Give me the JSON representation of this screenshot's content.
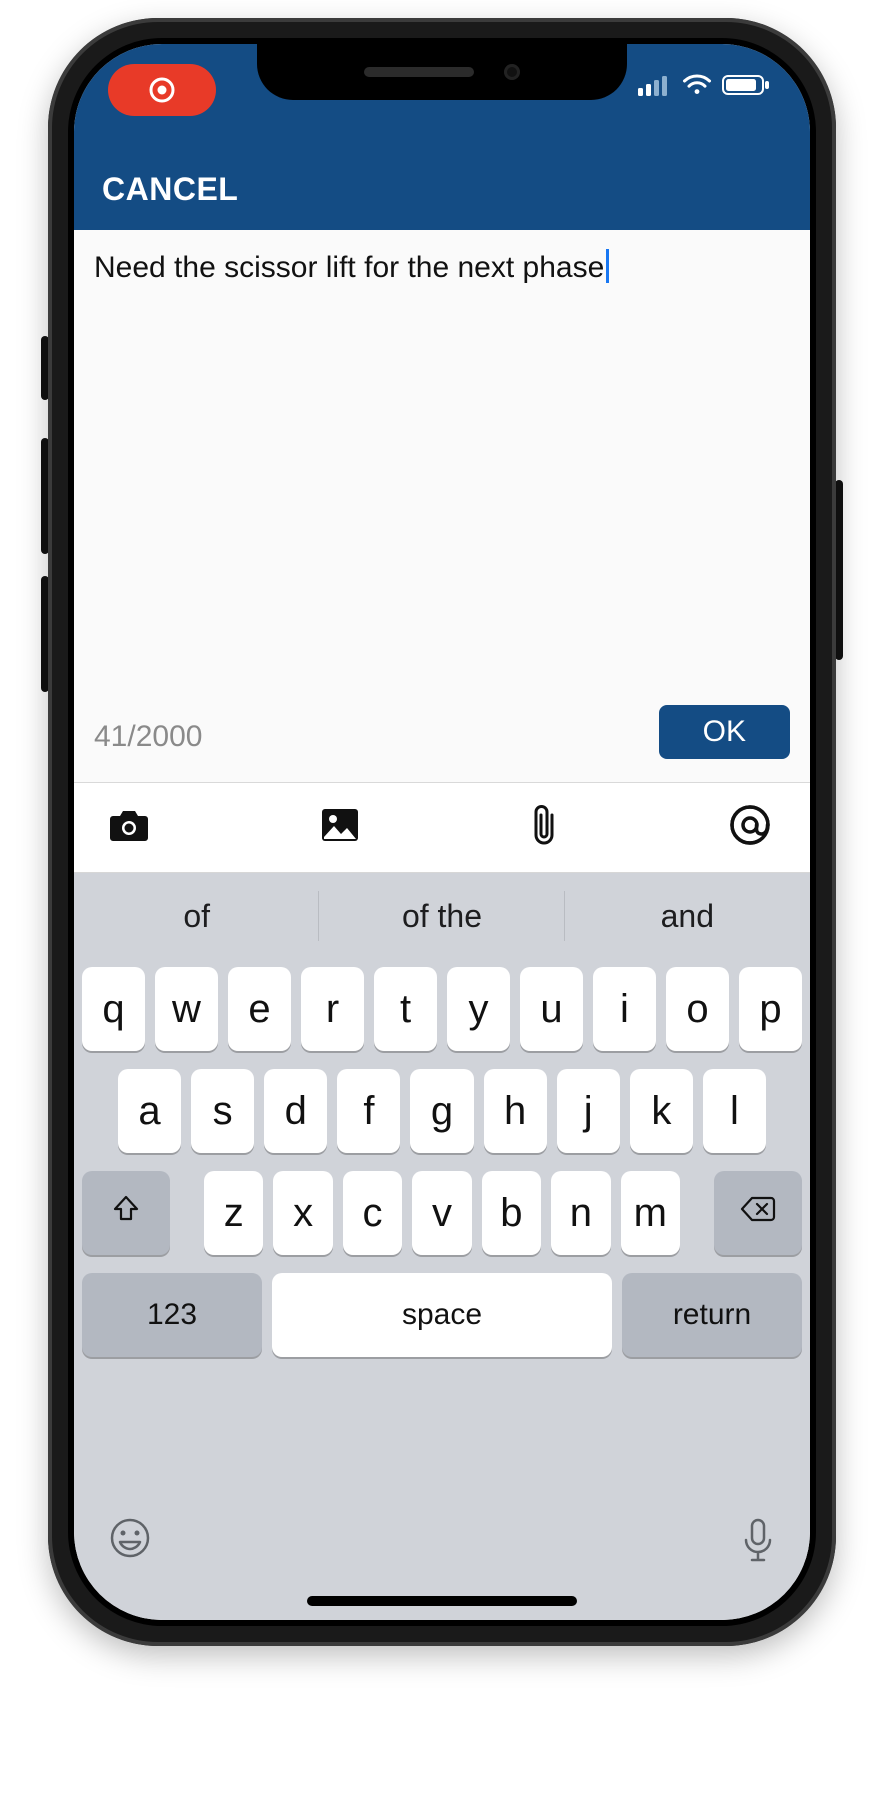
{
  "nav": {
    "cancel_label": "CANCEL"
  },
  "editor": {
    "text": "Need the scissor lift for the next phase",
    "char_count": "41/2000",
    "ok_label": "OK"
  },
  "attach_bar": {
    "camera_icon": "camera-icon",
    "gallery_icon": "image-icon",
    "paperclip_icon": "paperclip-icon",
    "mention_icon": "at-icon"
  },
  "status": {
    "recording_icon": "record-icon",
    "signal_icon": "cellular-signal-icon",
    "wifi_icon": "wifi-icon",
    "battery_icon": "battery-icon"
  },
  "keyboard": {
    "suggestions": [
      "of",
      "of the",
      "and"
    ],
    "row1": [
      "q",
      "w",
      "e",
      "r",
      "t",
      "y",
      "u",
      "i",
      "o",
      "p"
    ],
    "row2": [
      "a",
      "s",
      "d",
      "f",
      "g",
      "h",
      "j",
      "k",
      "l"
    ],
    "row3": [
      "z",
      "x",
      "c",
      "v",
      "b",
      "n",
      "m"
    ],
    "numbers_label": "123",
    "space_label": "space",
    "return_label": "return",
    "emoji_icon": "emoji-icon",
    "mic_icon": "microphone-icon"
  },
  "colors": {
    "brand": "#144c84",
    "recording": "#e83a28"
  }
}
